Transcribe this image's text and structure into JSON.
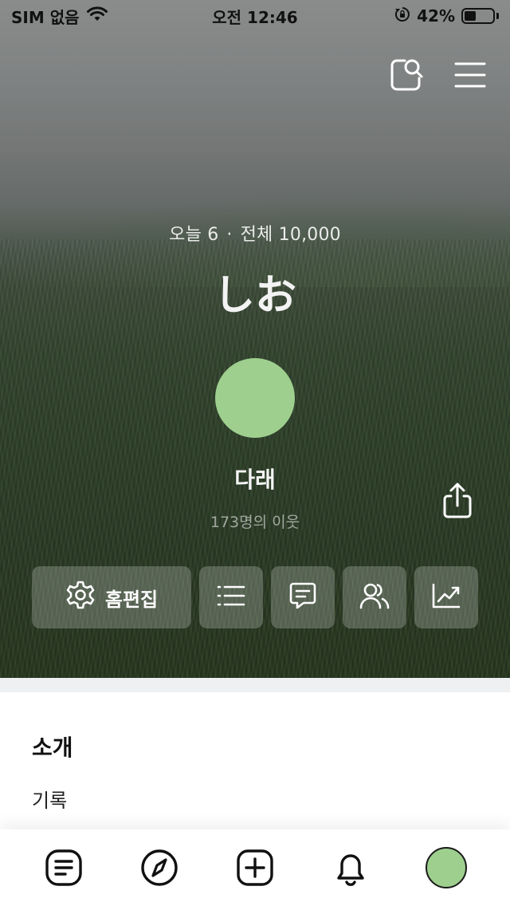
{
  "status_bar": {
    "carrier": "SIM 없음",
    "time": "오전 12:46",
    "battery_percent": "42%",
    "battery_level": 0.42,
    "icons": [
      "wifi-icon",
      "orientation-lock-icon",
      "battery-icon"
    ]
  },
  "header": {
    "icons": [
      "search-page-icon",
      "menu-icon"
    ]
  },
  "stats": {
    "today_label": "오늘 6",
    "separator": "·",
    "total_label": "전체 10,000"
  },
  "blog": {
    "title": "しお"
  },
  "profile": {
    "avatar_color": "#9ecf8e",
    "nickname": "다래",
    "neighbors": "173명의 이웃"
  },
  "actions": {
    "edit_home_label": "홈편집",
    "icons": [
      "gear-icon",
      "list-icon",
      "comment-icon",
      "neighbors-icon",
      "stats-icon",
      "share-icon"
    ]
  },
  "intro": {
    "title": "소개",
    "item": "기록"
  },
  "tab_bar": {
    "items": [
      "feed-icon",
      "explore-icon",
      "write-icon",
      "notification-icon",
      "my-avatar"
    ]
  }
}
